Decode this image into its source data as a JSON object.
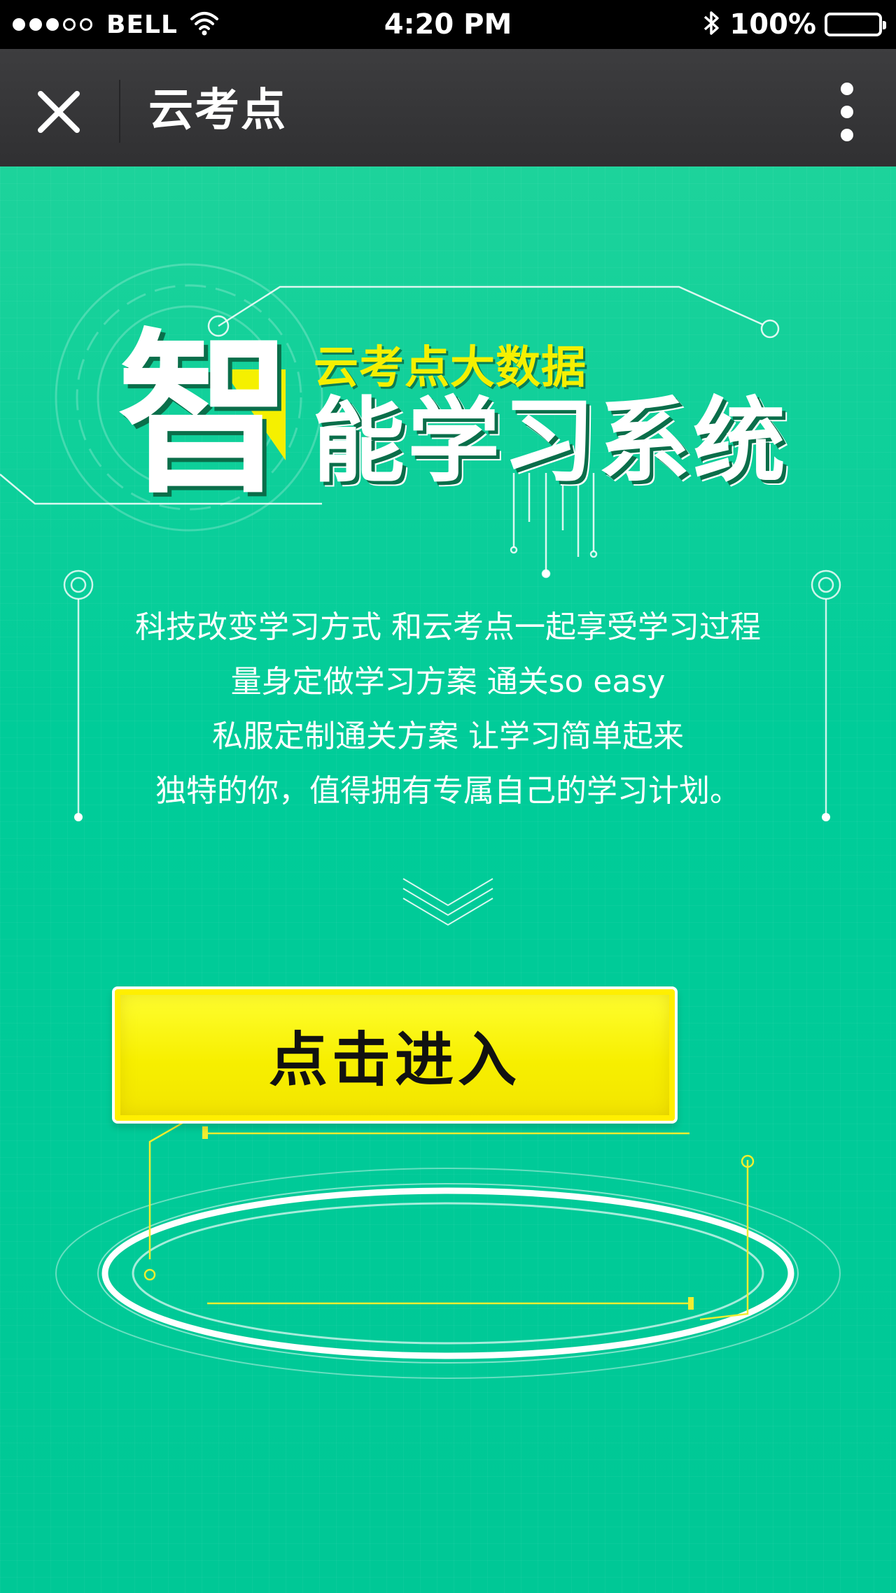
{
  "status_bar": {
    "carrier": "BELL",
    "time": "4:20 PM",
    "battery": "100%",
    "signal_icon": "signal-dots-icon",
    "wifi_icon": "wifi-icon",
    "bluetooth_icon": "bluetooth-icon",
    "battery_icon": "battery-icon"
  },
  "nav": {
    "title": "云考点",
    "close_icon": "close-icon",
    "more_icon": "more-vertical-icon"
  },
  "hero": {
    "big_char": "智",
    "subtitle": "云考点大数据",
    "headline": "能学习系统"
  },
  "description": [
    "科技改变学习方式  和云考点一起享受学习过程",
    "量身定做学习方案  通关so easy",
    "私服定制通关方案  让学习简单起来",
    "独特的你，值得拥有专属自己的学习计划。"
  ],
  "enter_button": {
    "label": "点击进入"
  },
  "colors": {
    "background": "#00cc99",
    "accent_yellow": "#f5f000",
    "navbar": "#363638"
  }
}
